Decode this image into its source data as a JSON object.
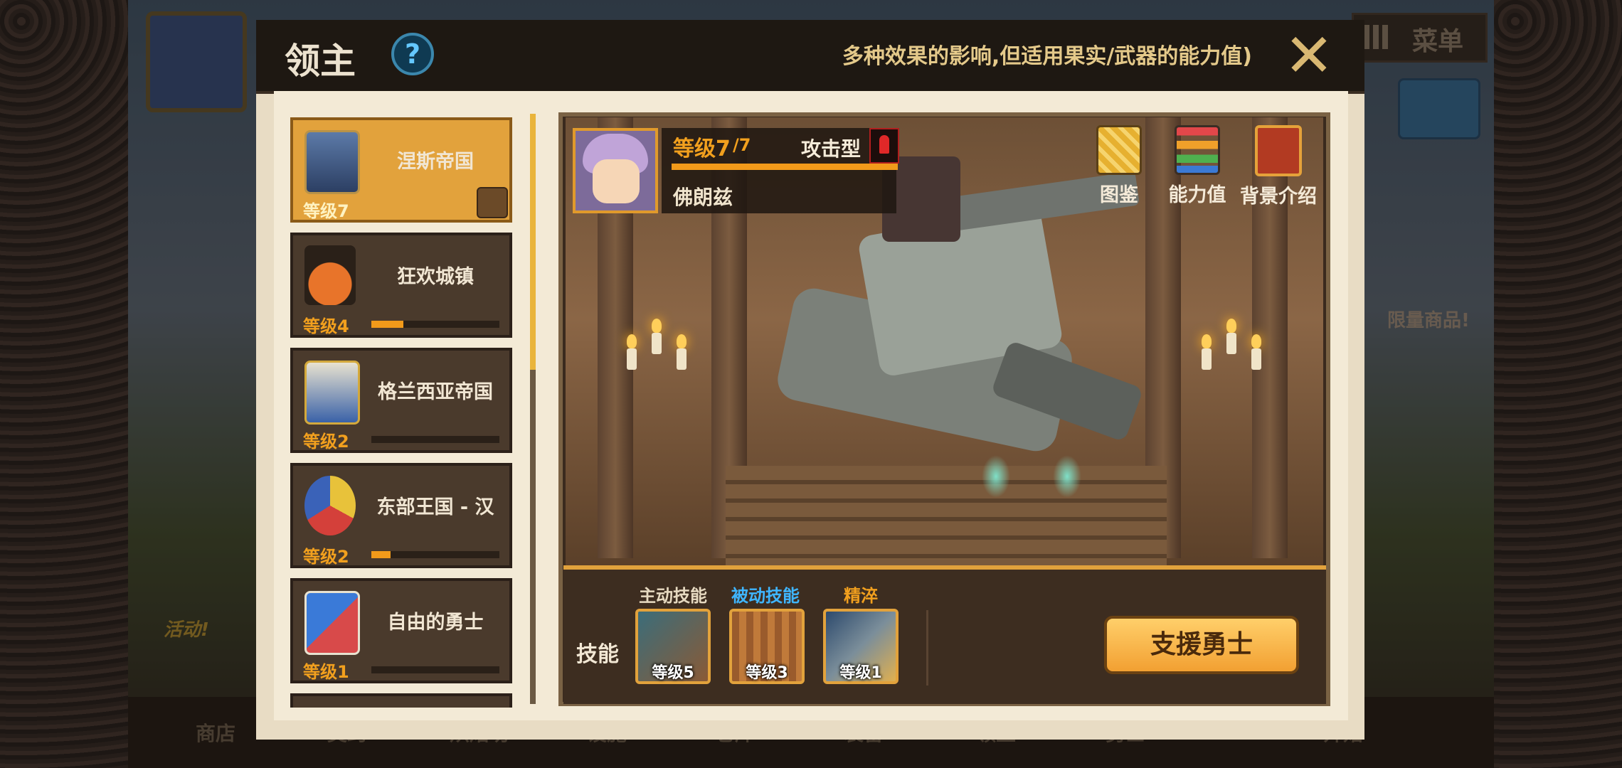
{
  "background": {
    "menu_label": "菜单",
    "limited_label": "限量商品!",
    "event_label": "活动!",
    "bottom_nav": [
      "商店",
      "契约",
      "烘焙坊",
      "设施",
      "仓库",
      "装备",
      "领主",
      "勇士",
      "开始"
    ]
  },
  "modal": {
    "title": "领主",
    "help_symbol": "?",
    "marquee_text": "多种效果的影响,但适用果实/武器的能力值)",
    "close_symbol": "✕"
  },
  "lords": [
    {
      "name": "涅斯帝国",
      "level": "等级7",
      "progress": 1.0,
      "selected": true
    },
    {
      "name": "狂欢城镇",
      "level": "等级4",
      "progress": 0.25,
      "selected": false
    },
    {
      "name": "格兰西亚帝国",
      "level": "等级2",
      "progress": 0.0,
      "selected": false
    },
    {
      "name": "东部王国 - 汉",
      "level": "等级2",
      "progress": 0.15,
      "selected": false
    },
    {
      "name": "自由的勇士",
      "level": "等级1",
      "progress": 0.0,
      "selected": false
    }
  ],
  "hero": {
    "level_label": "等级7",
    "level_max": "/7",
    "xp_progress": 1.0,
    "name": "佛朗兹",
    "type": "攻击型"
  },
  "side_buttons": {
    "codex": "图鉴",
    "stats": "能力值",
    "story": "背景介绍"
  },
  "skills": {
    "label": "技能",
    "active_header": "主动技能",
    "passive_header": "被动技能",
    "refine_header": "精淬",
    "active_level": "等级5",
    "passive_level": "等级3",
    "refine_level": "等级1"
  },
  "support_button": "支援勇士",
  "colors": {
    "accent_orange": "#f2a01e",
    "passive_blue": "#3fb6ff",
    "header_dark": "#1e1812",
    "panel_cream": "#f3ead6"
  }
}
